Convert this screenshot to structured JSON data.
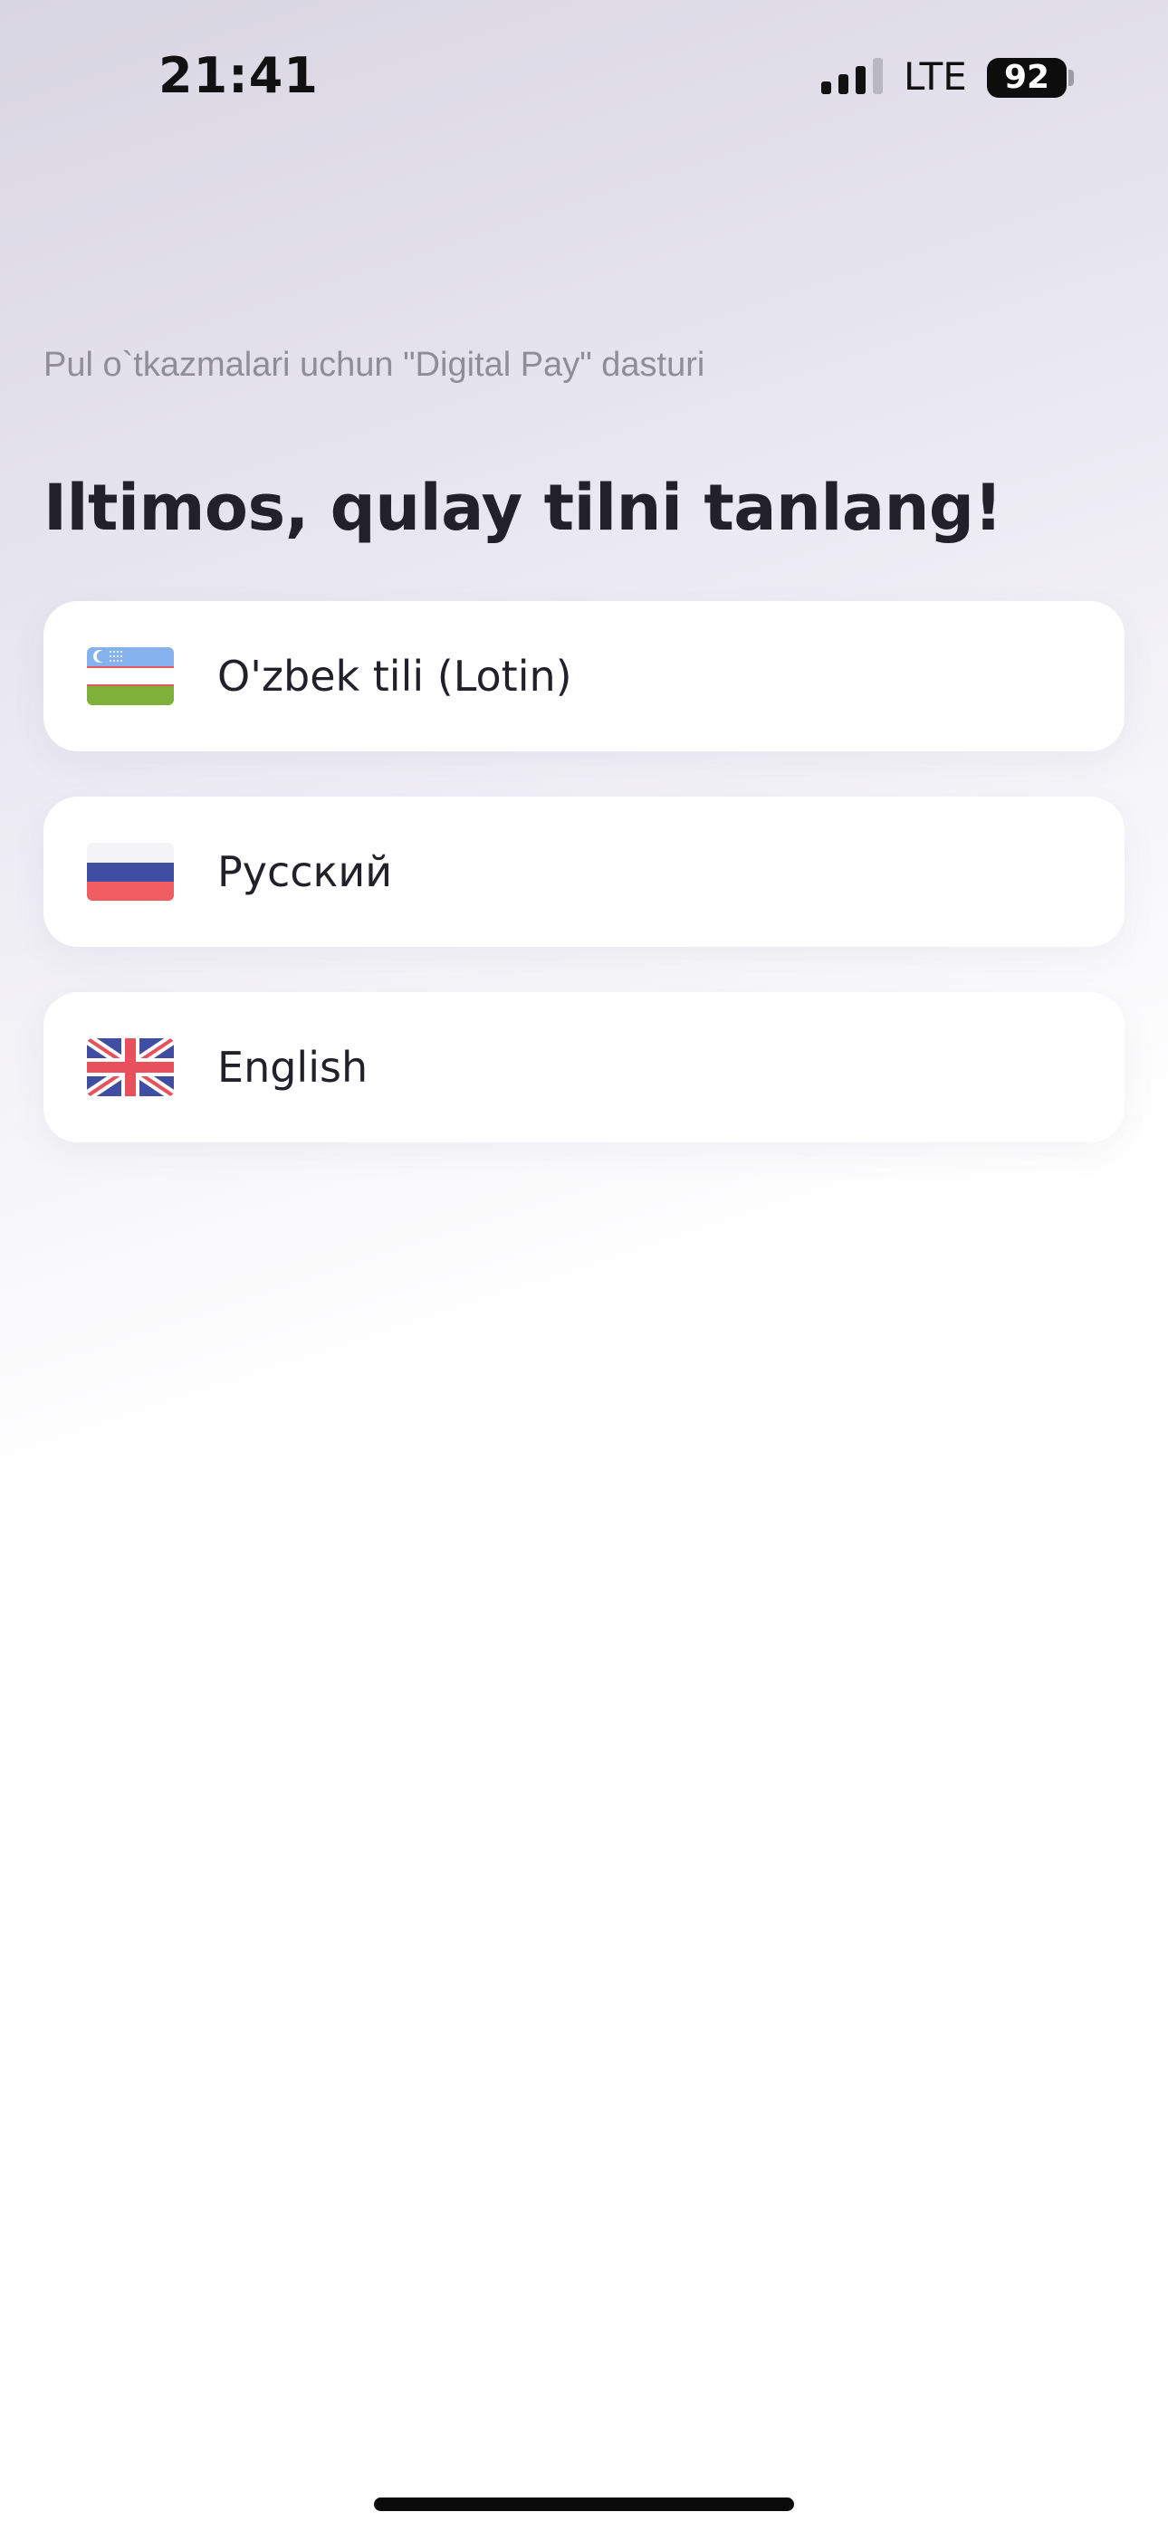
{
  "status_bar": {
    "time": "21:41",
    "network": "LTE",
    "battery": "92",
    "signal_icon": "signal-bars-icon"
  },
  "subtitle": "Pul o`tkazmalari uchun \"Digital Pay\" dasturi",
  "heading": "Iltimos, qulay tilni tanlang!",
  "languages": [
    {
      "label": "O'zbek tili (Lotin)",
      "flag_icon": "uzbekistan-flag-icon"
    },
    {
      "label": "Русский",
      "flag_icon": "russia-flag-icon"
    },
    {
      "label": "English",
      "flag_icon": "uk-flag-icon"
    }
  ],
  "colors": {
    "text_dark": "#222129",
    "text_muted": "#8f8d98",
    "card_bg": "#ffffff"
  }
}
